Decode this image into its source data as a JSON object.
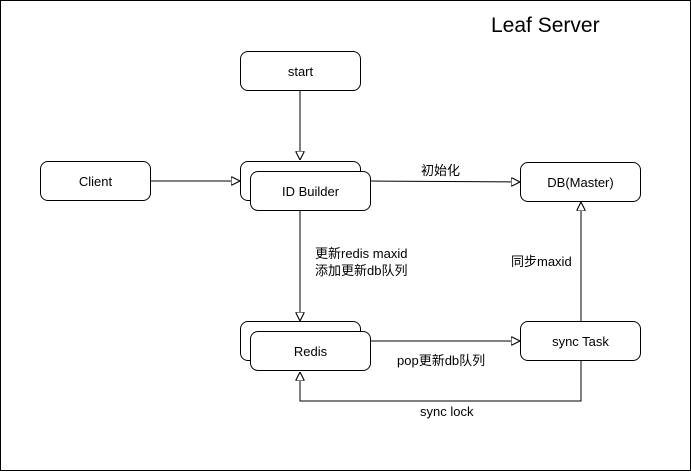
{
  "diagram": {
    "title": "Leaf Server",
    "nodes": {
      "start": "start",
      "client": "Client",
      "id_builder": "ID Builder",
      "db_master": "DB(Master)",
      "redis": "Redis",
      "sync_task": "sync Task"
    },
    "edge_labels": {
      "init": "初始化",
      "update_redis_line1": "更新redis maxid",
      "update_redis_line2": "添加更新db队列",
      "sync_maxid": "同步maxid",
      "pop_update": "pop更新db队列",
      "sync_lock": "sync lock"
    },
    "colors": {
      "stroke": "#000000",
      "fill": "#ffffff",
      "background": "#ffffff"
    }
  }
}
